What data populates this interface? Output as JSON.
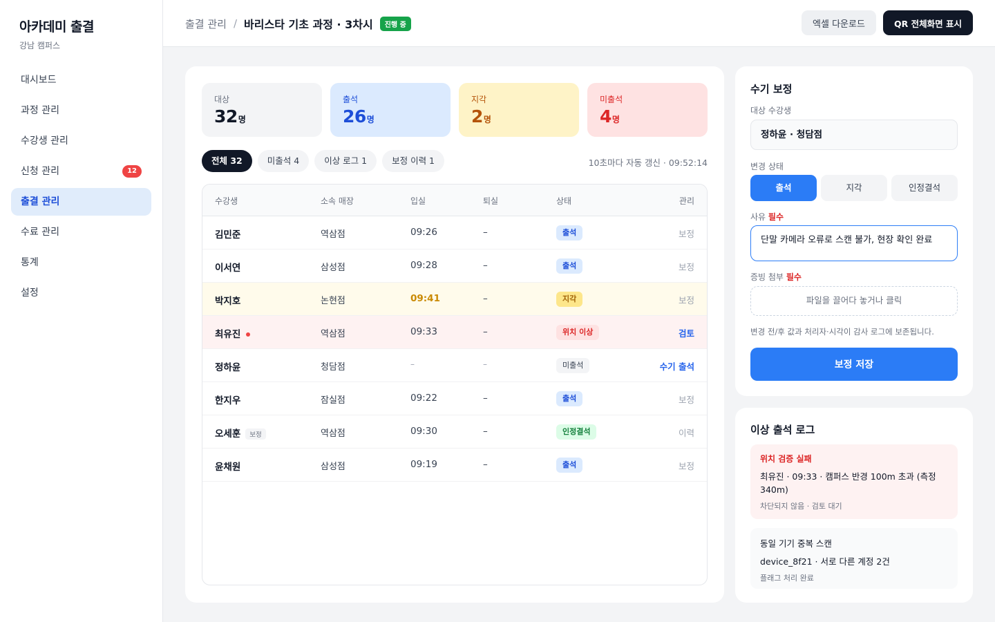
{
  "brand": {
    "title": "아카데미 출결",
    "subtitle": "강남 캠퍼스"
  },
  "sidebar": {
    "items": [
      {
        "label": "대시보드"
      },
      {
        "label": "과정 관리"
      },
      {
        "label": "수강생 관리"
      },
      {
        "label": "신청 관리",
        "badge": "12"
      },
      {
        "label": "출결 관리",
        "active": true
      },
      {
        "label": "수료 관리"
      },
      {
        "label": "통계"
      },
      {
        "label": "설정"
      }
    ]
  },
  "header": {
    "breadcrumb_parent": "출결 관리",
    "breadcrumb_sep": "/",
    "session_title": "바리스타 기초 과정 · 3차시",
    "status_badge": "진행 중",
    "excel_button": "엑셀 다운로드",
    "qr_button": "QR 전체화면 표시"
  },
  "stats": {
    "total": {
      "label": "대상",
      "value": "32",
      "unit": "명"
    },
    "present": {
      "label": "출석",
      "value": "26",
      "unit": "명"
    },
    "late": {
      "label": "지각",
      "value": "2",
      "unit": "명"
    },
    "absent": {
      "label": "미출석",
      "value": "4",
      "unit": "명"
    }
  },
  "filters": [
    {
      "label": "전체 32",
      "active": true
    },
    {
      "label": "미출석 4"
    },
    {
      "label": "이상 로그 1"
    },
    {
      "label": "보정 이력 1"
    }
  ],
  "refresh_text": "10초마다 자동 갱신 · 09:52:14",
  "table": {
    "headers": {
      "name": "수강생",
      "store": "소속 매장",
      "in": "입실",
      "out": "퇴실",
      "status": "상태",
      "action": "관리"
    },
    "rows": [
      {
        "name": "김민준",
        "store": "역삼점",
        "in": "09:26",
        "out": "–",
        "status": "출석",
        "action": "보정"
      },
      {
        "name": "이서연",
        "store": "삼성점",
        "in": "09:28",
        "out": "–",
        "status": "출석",
        "action": "보정"
      },
      {
        "name": "박지호",
        "store": "논현점",
        "in": "09:41",
        "out": "–",
        "status": "지각",
        "action": "보정"
      },
      {
        "name": "최유진",
        "store": "역삼점",
        "in": "09:33",
        "out": "–",
        "status": "위치 이상",
        "action": "검토"
      },
      {
        "name": "정하윤",
        "store": "청담점",
        "in": "–",
        "out": "–",
        "status": "미출석",
        "action": "수기 출석"
      },
      {
        "name": "한지우",
        "store": "잠실점",
        "in": "09:22",
        "out": "–",
        "status": "출석",
        "action": "보정"
      },
      {
        "name": "오세훈",
        "tag": "보정",
        "store": "역삼점",
        "in": "09:30",
        "out": "–",
        "status": "인정결석",
        "action": "이력"
      },
      {
        "name": "윤채원",
        "store": "삼성점",
        "in": "09:19",
        "out": "–",
        "status": "출석",
        "action": "보정"
      }
    ]
  },
  "fix_panel": {
    "title": "수기 보정",
    "target_label": "대상 수강생",
    "target_value": "정하윤 · 청담점",
    "status_label": "변경 상태",
    "status_options": [
      "출석",
      "지각",
      "인정결석"
    ],
    "selected_status": "출석",
    "reason_label": "사유",
    "required": "필수",
    "reason_value": "단말 카메라 오류로 스캔 불가, 현장 확인 완료",
    "evidence_label": "증빙 첨부",
    "dropzone_text": "파일을 끌어다 놓거나 클릭",
    "audit_note": "변경 전/후 값과 처리자·시각이 감사 로그에 보존됩니다.",
    "save_button": "보정 저장"
  },
  "log_panel": {
    "title": "이상 출석 로그",
    "entries": [
      {
        "title": "위치 검증 실패",
        "detail": "최유진 · 09:33 · 캠퍼스 반경 100m 초과 (측정 340m)",
        "footer": "차단되지 않음 · 검토 대기"
      },
      {
        "title": "동일 기기 중복 스캔",
        "detail": "device_8f21 · 서로 다른 계정 2건",
        "footer": "플래그 처리 완료"
      }
    ]
  },
  "colors": {
    "accent": "#2b7cf6",
    "present": "#1d4ed8",
    "late": "#b45309",
    "absent": "#dc2626",
    "excused": "#15803d"
  }
}
